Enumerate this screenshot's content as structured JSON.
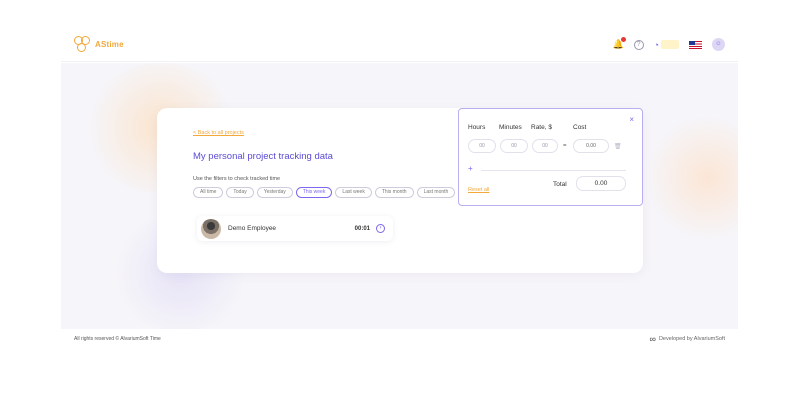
{
  "app": {
    "logo_text": "AStime"
  },
  "header": {
    "notification_count": "1",
    "help_glyph": "?",
    "language": "en-US"
  },
  "card": {
    "back_link": "< Back to all projects",
    "title": "My personal project tracking data",
    "filter_hint": "Use the filters to check tracked time",
    "filters": [
      "All time",
      "Today",
      "Yesterday",
      "This week",
      "Last week",
      "This month",
      "Last month"
    ],
    "active_filter": "This week"
  },
  "employee": {
    "name": "Demo Employee",
    "time": "00:01",
    "go_glyph": "›"
  },
  "popup": {
    "close_glyph": "×",
    "headers": {
      "hours": "Hours",
      "minutes": "Minutes",
      "rate": "Rate, $",
      "cost": "Cost"
    },
    "fields": {
      "hours": "00",
      "minutes": "00",
      "rate": "00",
      "cost": "0.00"
    },
    "minus_glyph": "=",
    "plus_glyph": "+",
    "reset_all": "Reset all",
    "total_label": "Total",
    "total_value": "0.00"
  },
  "footer": {
    "copyright": "All rights reserved © AlvariumSoft Time",
    "developed_by": "Developed by AlvariumSoft"
  },
  "colors": {
    "accent": "#7b68ee",
    "brand": "#f2a83b",
    "background": "#f6f5f9"
  },
  "icons": [
    "logo-mark-icon",
    "bell-icon",
    "help-icon",
    "timer-icon",
    "us-flag-icon",
    "avatar-icon",
    "close-icon",
    "arrow-right-icon",
    "delete-icon",
    "alvariumsoft-logo-icon"
  ]
}
